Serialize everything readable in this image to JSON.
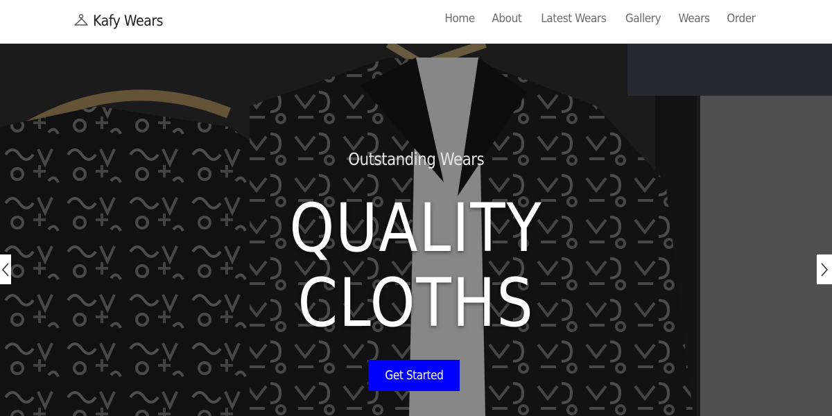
{
  "brand": {
    "name": "Kafy Wears",
    "icon": "hanger-icon"
  },
  "nav": {
    "items": [
      {
        "label": "Home"
      },
      {
        "label": "About"
      },
      {
        "label": "Latest Wears"
      },
      {
        "label": "Gallery"
      },
      {
        "label": "Wears"
      },
      {
        "label": "Order"
      }
    ]
  },
  "hero": {
    "subtitle": "Outstanding Wears",
    "title_line1": "QUALITY",
    "title_line2": "CLOTHS",
    "cta_label": "Get Started",
    "prev_icon": "chevron-left-icon",
    "next_icon": "chevron-right-icon"
  },
  "colors": {
    "cta_background": "#0000ff",
    "nav_text": "#6b6b6b",
    "brand_text": "#1c1c1c"
  }
}
